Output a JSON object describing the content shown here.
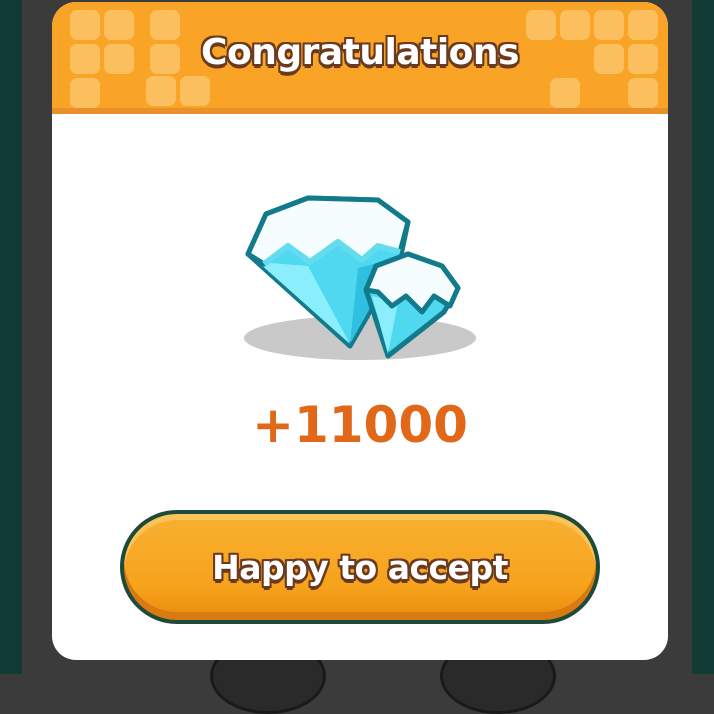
{
  "dialog": {
    "title": "Congratulations",
    "reward_icon": "ice-crystal-icon",
    "reward_amount": "+11000",
    "accept_label": "Happy to accept"
  },
  "colors": {
    "header": "#f9a426",
    "amount": "#e06818",
    "button": "#f6a21c",
    "text_outline": "#6b3a1e"
  }
}
